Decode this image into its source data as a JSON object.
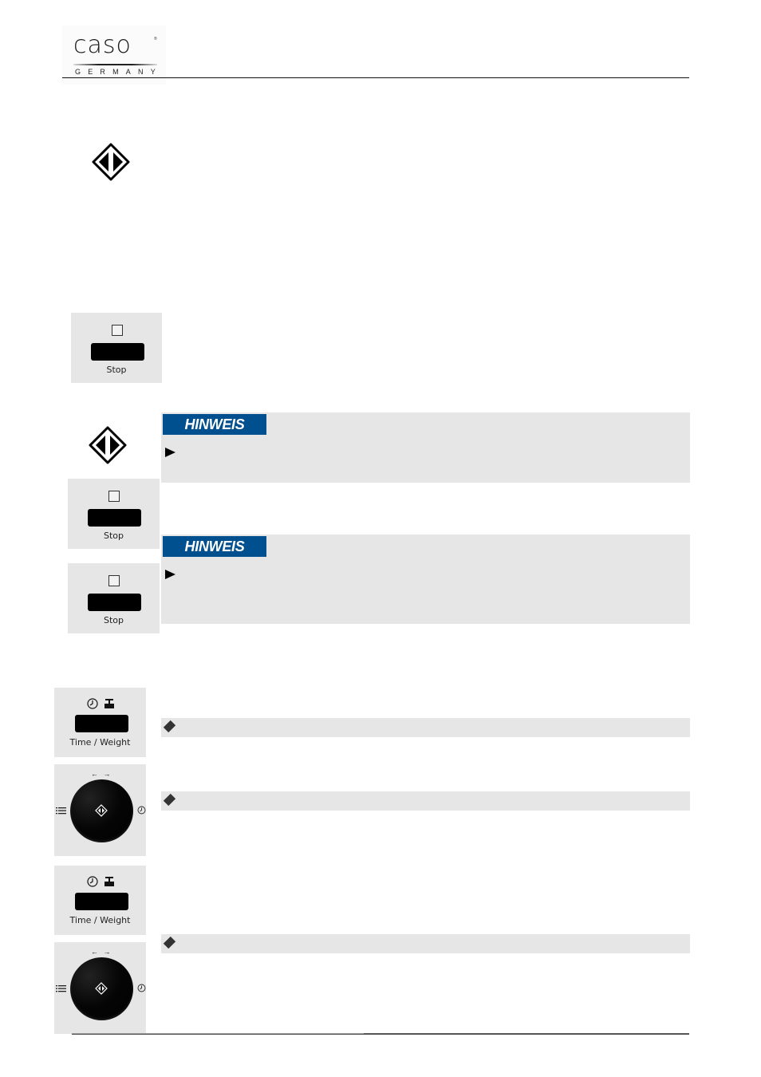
{
  "header": {
    "logo": {
      "brand": "caso",
      "registered": "®",
      "sub": "GERMANY"
    }
  },
  "icons": {
    "start": "start-diamond-icon",
    "stop_square": "stop-square-icon",
    "clock": "clock-icon",
    "weight": "weight-icon",
    "list": "list-icon",
    "arrow": "triangle-right-icon",
    "bullet": "diamond-bullet-icon"
  },
  "controls": {
    "stop_label": "Stop",
    "time_weight_label": "Time / Weight",
    "knob_arrows": "← →"
  },
  "notes": [
    {
      "tag": "HINWEIS"
    },
    {
      "tag": "HINWEIS"
    }
  ],
  "colors": {
    "hinweis_blue": "#004f8f",
    "panel_gray": "#e6e6e6"
  }
}
